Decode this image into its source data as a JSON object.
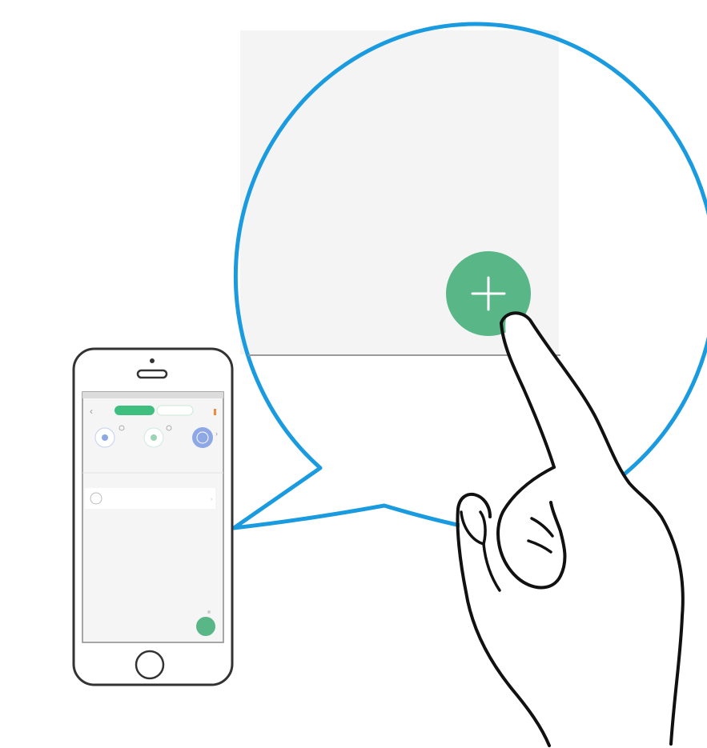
{
  "illustration": {
    "colors": {
      "bubble_outline": "#1a9be0",
      "bubble_fill": "#f4f4f4",
      "add_button": "#58b687",
      "add_symbol": "#ffffff",
      "hand_outline": "#111111",
      "phone_outline": "#333333",
      "phone_screen_bg": "#f5f5f5",
      "phone_accent": "#3fbf7f",
      "device_icon_blue": "#8ea8e6",
      "tab_orange": "#f08a3c"
    },
    "zoom_bubble": {
      "add_button_icon": "plus-icon"
    },
    "phone": {
      "top_tab_active": "",
      "top_tab_inactive": "",
      "devices": [
        "",
        "",
        ""
      ],
      "section_label": "",
      "list_item_title": "",
      "list_item_subtitle": "",
      "fab_icon": "plus-icon"
    }
  }
}
